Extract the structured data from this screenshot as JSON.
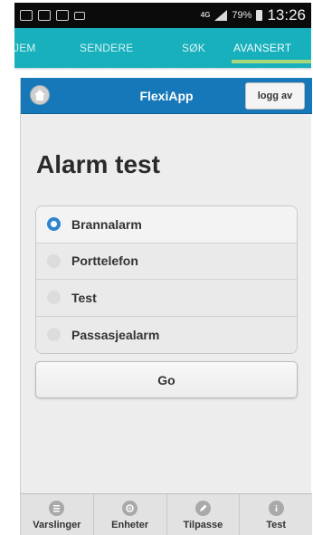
{
  "status_bar": {
    "network": "4G",
    "battery": "79%",
    "time": "13:26"
  },
  "tabs": [
    {
      "label": "JEM"
    },
    {
      "label": "SENDERE"
    },
    {
      "label": "SØK"
    },
    {
      "label": "AVANSERT",
      "active": true
    }
  ],
  "header": {
    "title": "FlexiApp",
    "logout_label": "logg av",
    "home_icon": "home-icon"
  },
  "page": {
    "title": "Alarm test"
  },
  "alarm_options": [
    {
      "label": "Brannalarm",
      "selected": true
    },
    {
      "label": "Porttelefon",
      "selected": false
    },
    {
      "label": "Test",
      "selected": false
    },
    {
      "label": "Passasjealarm",
      "selected": false
    }
  ],
  "go_label": "Go",
  "bottom_nav": [
    {
      "label": "Varslinger",
      "icon": "list-icon"
    },
    {
      "label": "Enheter",
      "icon": "gear-icon"
    },
    {
      "label": "Tilpasse",
      "icon": "pencil-icon"
    },
    {
      "label": "Test",
      "icon": "info-icon"
    }
  ],
  "colors": {
    "tab_bar": "#17b0bc",
    "header": "#1778b9",
    "selected_radio": "#2f85d0",
    "tab_underline": "#a9d87b"
  }
}
